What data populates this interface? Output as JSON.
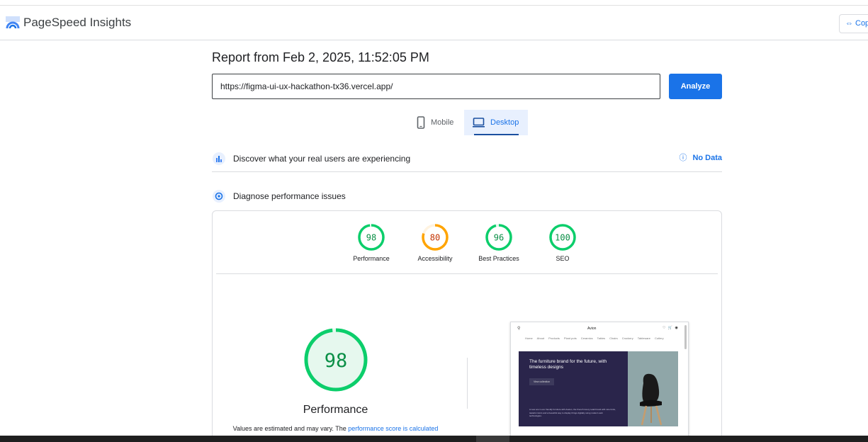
{
  "app": {
    "brand": "PageSpeed Insights",
    "copy_label": "Cop"
  },
  "report": {
    "title": "Report from Feb 2, 2025, 11:52:05 PM"
  },
  "search": {
    "url": "https://figma-ui-ux-hackathon-tx36.vercel.app/",
    "analyze_label": "Analyze"
  },
  "tabs": {
    "mobile": "Mobile",
    "desktop": "Desktop",
    "active": "Desktop"
  },
  "field_data": {
    "label": "Discover what your real users are experiencing",
    "status": "No Data"
  },
  "lab_data": {
    "label": "Diagnose performance issues"
  },
  "colors": {
    "pass": "#0cce6b",
    "average": "#ffa400",
    "accent": "#1a73e8"
  },
  "gauges": [
    {
      "label": "Performance",
      "score": "98",
      "value": 98,
      "status": "pass"
    },
    {
      "label": "Accessibility",
      "score": "80",
      "value": 80,
      "status": "average"
    },
    {
      "label": "Best Practices",
      "score": "96",
      "value": 96,
      "status": "pass"
    },
    {
      "label": "SEO",
      "score": "100",
      "value": 100,
      "status": "pass"
    }
  ],
  "main_score": {
    "score": "98",
    "value": 98,
    "label": "Performance"
  },
  "note": {
    "text": "Values are estimated and may vary. The ",
    "link": "performance score is calculated"
  },
  "screenshot": {
    "brand": "Avion",
    "icons": "♡ 🛒 ◉",
    "nav": [
      "Home",
      "About",
      "Products",
      "Plant pots",
      "Ceramics",
      "Tables",
      "Chairs",
      "Crockery",
      "Tableware",
      "Cutlery"
    ],
    "hero_title": "The furniture brand for the future, with timeless designs",
    "hero_button": "View collection",
    "hero_text": "A new era in eco friendly furniture with Avelon, the French luxury retail brand with nice fonts, tasteful colors and a beautiful way to display things digitally using modern web technologies."
  }
}
